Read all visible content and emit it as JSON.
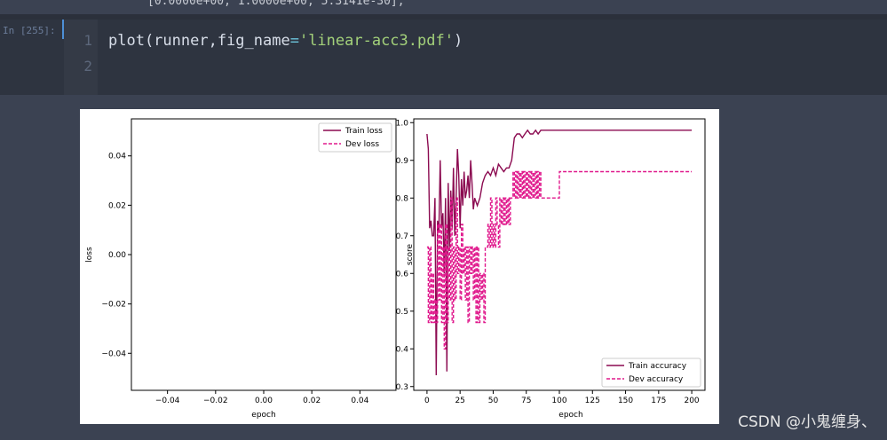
{
  "notebook": {
    "prev_output_text": "[0.0000e+00, 1.0000e+00, 5.3141e-30],",
    "prompt": "In [255]:",
    "line_numbers": [
      "1",
      "2"
    ],
    "code": {
      "fn": "plot(runner,fig_name",
      "op": "=",
      "str": "'linear-acc3.pdf'",
      "close": ")"
    }
  },
  "watermark": "CSDN @小鬼缠身、",
  "colors": {
    "train": "#8b0a50",
    "dev": "#e0188c",
    "cell_bg": "#2e3440",
    "page_bg": "#3b4252"
  },
  "chart_data": [
    {
      "type": "line",
      "xlabel": "epoch",
      "ylabel": "loss",
      "xticks": [
        "−0.04",
        "−0.02",
        "0.00",
        "0.02",
        "0.04"
      ],
      "yticks": [
        "0.04",
        "0.02",
        "0.00",
        "−0.02",
        "−0.04"
      ],
      "xlim": [
        -0.055,
        0.055
      ],
      "ylim": [
        -0.055,
        0.055
      ],
      "legend": {
        "placement": "upper-right",
        "entries": [
          {
            "name": "Train loss",
            "style": "solid"
          },
          {
            "name": "Dev loss",
            "style": "dashed"
          }
        ]
      },
      "series": [
        {
          "name": "Train loss",
          "x": [],
          "y": []
        },
        {
          "name": "Dev loss",
          "x": [],
          "y": []
        }
      ]
    },
    {
      "type": "line",
      "xlabel": "epoch",
      "ylabel": "score",
      "xlim": [
        -10,
        210
      ],
      "ylim": [
        0.29,
        1.01
      ],
      "xticks": [
        "0",
        "25",
        "50",
        "75",
        "100",
        "125",
        "150",
        "175",
        "200"
      ],
      "xtick_values": [
        0,
        25,
        50,
        75,
        100,
        125,
        150,
        175,
        200
      ],
      "yticks": [
        "1.0",
        "0.9",
        "0.8",
        "0.7",
        "0.6",
        "0.5",
        "0.4",
        "0.3"
      ],
      "ytick_values": [
        1.0,
        0.9,
        0.8,
        0.7,
        0.6,
        0.5,
        0.4,
        0.3
      ],
      "legend": {
        "placement": "lower-right",
        "entries": [
          {
            "name": "Train accuracy",
            "style": "solid"
          },
          {
            "name": "Dev accuracy",
            "style": "dashed"
          }
        ]
      },
      "series": [
        {
          "name": "Train accuracy",
          "x": [
            0,
            1,
            2,
            3,
            4,
            5,
            6,
            7,
            8,
            9,
            10,
            11,
            12,
            13,
            14,
            15,
            16,
            17,
            18,
            19,
            20,
            21,
            22,
            23,
            24,
            25,
            26,
            27,
            28,
            29,
            30,
            31,
            32,
            33,
            34,
            35,
            36,
            37,
            38,
            40,
            42,
            44,
            46,
            48,
            50,
            52,
            54,
            56,
            58,
            60,
            62,
            64,
            66,
            68,
            70,
            72,
            74,
            76,
            78,
            80,
            82,
            84,
            86,
            90,
            100,
            150,
            200
          ],
          "y": [
            0.97,
            0.93,
            0.72,
            0.74,
            0.7,
            0.7,
            0.8,
            0.33,
            0.74,
            0.71,
            0.9,
            0.72,
            0.76,
            0.6,
            0.8,
            0.34,
            0.84,
            0.66,
            0.82,
            0.72,
            0.88,
            0.7,
            0.8,
            0.93,
            0.86,
            0.72,
            0.85,
            0.78,
            0.87,
            0.8,
            0.82,
            0.86,
            0.8,
            0.9,
            0.84,
            0.77,
            0.8,
            0.79,
            0.78,
            0.8,
            0.84,
            0.86,
            0.87,
            0.86,
            0.88,
            0.86,
            0.89,
            0.88,
            0.87,
            0.88,
            0.88,
            0.9,
            0.96,
            0.97,
            0.97,
            0.96,
            0.97,
            0.98,
            0.97,
            0.97,
            0.98,
            0.97,
            0.98,
            0.98,
            0.98,
            0.98,
            0.98
          ]
        },
        {
          "name": "Dev accuracy",
          "x": [
            0,
            1,
            2,
            3,
            4,
            5,
            6,
            7,
            8,
            9,
            10,
            11,
            12,
            13,
            14,
            15,
            16,
            17,
            18,
            19,
            20,
            21,
            22,
            23,
            24,
            25,
            26,
            27,
            28,
            29,
            30,
            31,
            32,
            33,
            34,
            35,
            36,
            37,
            38,
            39,
            40,
            41,
            42,
            43,
            44,
            45,
            46,
            47,
            48,
            49,
            50,
            51,
            52,
            53,
            54,
            55,
            56,
            57,
            58,
            59,
            60,
            61,
            62,
            63,
            64,
            65,
            66,
            67,
            68,
            69,
            70,
            71,
            72,
            73,
            74,
            75,
            76,
            77,
            78,
            79,
            80,
            81,
            82,
            83,
            84,
            85,
            86,
            90,
            95,
            99,
            100,
            150,
            200
          ],
          "y": [
            0.67,
            0.47,
            0.67,
            0.47,
            0.6,
            0.47,
            0.53,
            0.47,
            0.73,
            0.53,
            0.73,
            0.47,
            0.67,
            0.4,
            0.73,
            0.47,
            0.67,
            0.53,
            0.8,
            0.47,
            0.67,
            0.53,
            0.8,
            0.6,
            0.67,
            0.53,
            0.73,
            0.6,
            0.67,
            0.53,
            0.67,
            0.47,
            0.67,
            0.6,
            0.67,
            0.53,
            0.67,
            0.47,
            0.67,
            0.47,
            0.6,
            0.53,
            0.6,
            0.47,
            0.67,
            0.67,
            0.73,
            0.67,
            0.8,
            0.67,
            0.73,
            0.67,
            0.8,
            0.73,
            0.67,
            0.8,
            0.73,
            0.8,
            0.73,
            0.8,
            0.73,
            0.8,
            0.73,
            0.8,
            0.8,
            0.87,
            0.8,
            0.87,
            0.8,
            0.87,
            0.8,
            0.87,
            0.8,
            0.87,
            0.8,
            0.87,
            0.8,
            0.87,
            0.8,
            0.87,
            0.8,
            0.87,
            0.8,
            0.87,
            0.8,
            0.87,
            0.8,
            0.8,
            0.8,
            0.8,
            0.87,
            0.87,
            0.87
          ]
        }
      ]
    }
  ]
}
